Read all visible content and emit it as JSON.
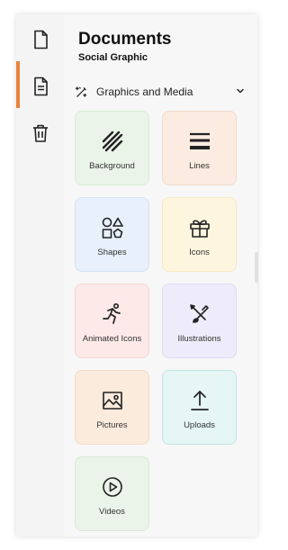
{
  "header": {
    "title": "Documents",
    "subtitle": "Social Graphic"
  },
  "rail": {
    "items": [
      {
        "name": "file-icon",
        "active": false
      },
      {
        "name": "document-text-icon",
        "active": true
      },
      {
        "name": "trash-icon",
        "active": false
      }
    ],
    "accent": "#e9843b"
  },
  "section": {
    "label": "Graphics and Media",
    "icon": "wand-sparkle-icon",
    "expanded": true
  },
  "tiles": [
    {
      "label": "Background",
      "icon": "hatch-icon",
      "bg": "#eaf4e8",
      "border": "#d8ead5"
    },
    {
      "label": "Lines",
      "icon": "lines-icon",
      "bg": "#fbebe0",
      "border": "#f3dac9"
    },
    {
      "label": "Shapes",
      "icon": "shapes-icon",
      "bg": "#e7f0fb",
      "border": "#d4e3f4"
    },
    {
      "label": "Icons",
      "icon": "gift-icon",
      "bg": "#fef5df",
      "border": "#f6e8c2"
    },
    {
      "label": "Animated Icons",
      "icon": "running-icon",
      "bg": "#fde9e8",
      "border": "#f6d6d4"
    },
    {
      "label": "Illustrations",
      "icon": "pen-brush-icon",
      "bg": "#eeecfb",
      "border": "#dedaf4"
    },
    {
      "label": "Pictures",
      "icon": "image-icon",
      "bg": "#fbebdd",
      "border": "#f3dac6"
    },
    {
      "label": "Uploads",
      "icon": "upload-icon",
      "bg": "#e5f6f5",
      "border": "#bfe5e2"
    },
    {
      "label": "Videos",
      "icon": "play-circle-icon",
      "bg": "#eaf4e8",
      "border": "#d8ead5"
    }
  ]
}
